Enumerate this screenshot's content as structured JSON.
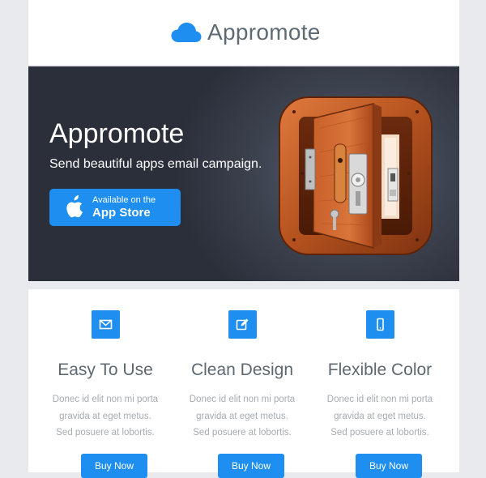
{
  "header": {
    "brand": "Appromote"
  },
  "hero": {
    "title": "Appromote",
    "subtitle": "Send beautiful apps email campaign.",
    "store_button": {
      "small_text": "Available on the",
      "big_text": "App Store"
    },
    "app_icon": "wooden-door-app-icon"
  },
  "features": [
    {
      "icon": "envelope-icon",
      "title": "Easy To Use",
      "desc_lines": [
        "Donec id elit non mi porta",
        "gravida at eget metus.",
        "Sed posuere at lobortis."
      ],
      "button": "Buy Now"
    },
    {
      "icon": "edit-icon",
      "title": "Clean Design",
      "desc_lines": [
        "Donec id elit non mi porta",
        "gravida at eget metus.",
        "Sed posuere at lobortis."
      ],
      "button": "Buy Now"
    },
    {
      "icon": "mobile-icon",
      "title": "Flexible Color",
      "desc_lines": [
        "Donec id elit non mi porta",
        "gravida at eget metus.",
        "Sed posuere at lobortis."
      ],
      "button": "Buy Now"
    }
  ],
  "colors": {
    "accent": "#1e8ef0",
    "page_bg": "#e9eaee",
    "hero_bg": "#3d424f",
    "title_text": "#5d6870",
    "muted_text": "#a6acb1"
  }
}
